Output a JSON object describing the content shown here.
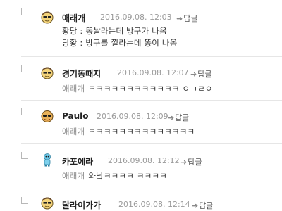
{
  "comments": [
    {
      "nick": "애래개",
      "date": "2016.09.08. 12:03",
      "reply_label": "답글",
      "lines": [
        "황당 : 똥쌀라는데 방구가 나옴",
        "당황 : 방구를 낄라는데 똥이 나옴"
      ]
    },
    {
      "nick": "경기똥때지",
      "date": "2016.09.08. 12:07",
      "reply_label": "답글",
      "mention": "애래개",
      "text": "ㅋㅋㅋㅋㅋㅋㅋㅋㅋㅋㅋㅋ ㅇㄱㄹㅇ"
    },
    {
      "nick": "Paulo",
      "date": "2016.09.08. 12:09",
      "reply_label": "답글",
      "mention": "애래개",
      "text": "ㅋㅋㅋㅋㅋㅋㅋㅋㅋㅋㅋㅋㅋㅋ"
    },
    {
      "nick": "카포에라",
      "date": "2016.09.08. 12:12",
      "reply_label": "답글",
      "mention": "애래개",
      "text": "와낰ㅋㅋㅋㅋ ㅋㅋㅋㅋ"
    },
    {
      "nick": "달라이가가",
      "date": "2016.09.08. 12:14",
      "reply_label": "답글"
    }
  ],
  "icons": {
    "reply_arrow": "reply-arrow-icon",
    "reply_marker": "reply-indent-icon",
    "avatar_face": "face-avatar-icon",
    "avatar_figure": "figure-avatar-icon"
  }
}
